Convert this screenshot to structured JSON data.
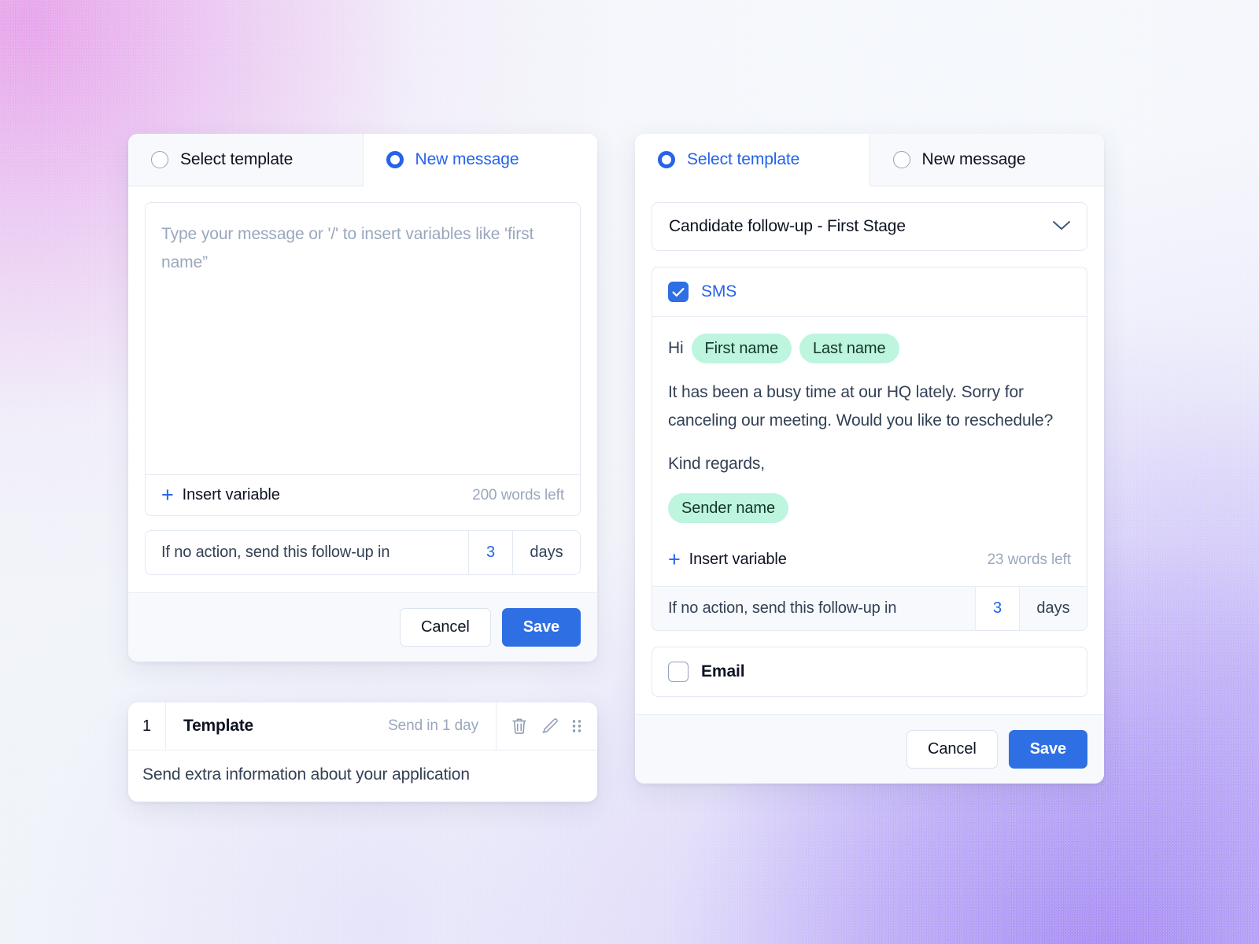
{
  "background": {
    "accent_pink": "#e496e8",
    "accent_purple": "#9676f2",
    "base": "#f4f7fb"
  },
  "theme": {
    "blue": "#2563eb",
    "save_blue": "#2f6fe4",
    "pill_green": "#bdf5de",
    "muted": "#9aa7bd",
    "border": "#e3e9f2"
  },
  "left_card": {
    "tabs": [
      {
        "label": "Select template",
        "selected": false
      },
      {
        "label": "New message",
        "selected": true
      }
    ],
    "editor": {
      "value": "",
      "placeholder": "Type your message or '/' to insert variables like 'first name”",
      "insert_variable_label": "Insert variable",
      "words_left": "200 words left"
    },
    "followup": {
      "label": "If no action, send this follow-up in",
      "value": "3",
      "unit": "days"
    },
    "footer": {
      "cancel_label": "Cancel",
      "save_label": "Save"
    }
  },
  "template_card": {
    "number": "1",
    "name": "Template",
    "schedule": "Send in 1 day",
    "description": "Send extra information about your application",
    "actions": [
      "delete-icon",
      "edit-icon",
      "drag-handle-icon"
    ]
  },
  "right_card": {
    "tabs": [
      {
        "label": "Select template",
        "selected": true
      },
      {
        "label": "New message",
        "selected": false
      }
    ],
    "template_select": {
      "value": "Candidate follow-up - First Stage",
      "chevron": "chevron-down-icon"
    },
    "sms": {
      "label": "SMS",
      "checked": true,
      "greeting_prefix": "Hi",
      "greeting_pills": [
        "First name",
        "Last name"
      ],
      "paragraph": "It has been a busy time at our HQ lately. Sorry for canceling our meeting. Would you like to reschedule?",
      "signoff": "Kind regards,",
      "signoff_pill": "Sender name",
      "insert_variable_label": "Insert variable",
      "words_left": "23 words left",
      "followup": {
        "label": "If no action, send this follow-up in",
        "value": "3",
        "unit": "days"
      }
    },
    "email": {
      "label": "Email",
      "checked": false
    },
    "footer": {
      "cancel_label": "Cancel",
      "save_label": "Save"
    }
  }
}
